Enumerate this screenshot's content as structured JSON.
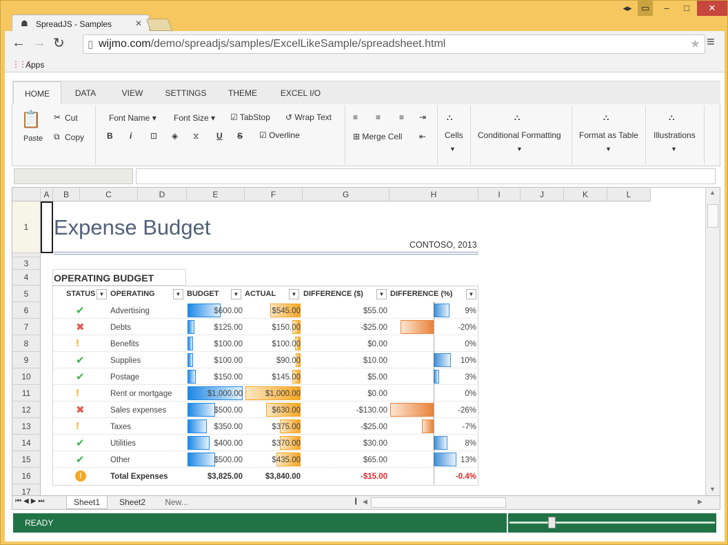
{
  "browser": {
    "tab_title": "SpreadJS - Samples",
    "url_host": "wijmo.com",
    "url_path": "/demo/spreadjs/samples/ExcelLikeSample/spreadsheet.html",
    "bookmarks_apps": "Apps"
  },
  "ribbon": {
    "tabs": [
      "HOME",
      "DATA",
      "VIEW",
      "SETTINGS",
      "THEME",
      "EXCEL I/O"
    ],
    "paste": "Paste",
    "cut": "Cut",
    "copy": "Copy",
    "font_name": "Font Name",
    "font_size": "Font Size",
    "bold": "B",
    "italic": "i",
    "underline": "U",
    "strike": "S",
    "tabstop": "TabStop",
    "wrap_text": "Wrap Text",
    "overline": "Overline",
    "merge_cell": "Merge Cell",
    "cells": "Cells",
    "conditional_formatting": "Conditional Formatting",
    "format_as_table": "Format as Table",
    "illustrations": "Illustrations"
  },
  "columns": [
    "A",
    "B",
    "C",
    "D",
    "E",
    "F",
    "G",
    "H",
    "I",
    "J",
    "K",
    "L"
  ],
  "rows": [
    "1",
    "3",
    "4",
    "5",
    "6",
    "7",
    "8",
    "9",
    "10",
    "11",
    "12",
    "13",
    "14",
    "15",
    "16",
    "17"
  ],
  "sheet": {
    "title": "Expense Budget",
    "company": "CONTOSO, 2013",
    "section": "OPERATING BUDGET",
    "headers": [
      "STATUS",
      "OPERATING",
      "BUDGET",
      "ACTUAL",
      "DIFFERENCE ($)",
      "DIFFERENCE (%)"
    ],
    "data_rows": [
      {
        "status": "ok",
        "name": "Advertising",
        "budget": "$600.00",
        "actual": "$545.00",
        "diff": "$55.00",
        "pct": "9%",
        "budget_v": 600,
        "actual_v": 545,
        "pct_v": 9
      },
      {
        "status": "bad",
        "name": "Debts",
        "budget": "$125.00",
        "actual": "$150.00",
        "diff": "-$25.00",
        "pct": "-20%",
        "budget_v": 125,
        "actual_v": 150,
        "pct_v": -20
      },
      {
        "status": "warn",
        "name": "Benefits",
        "budget": "$100.00",
        "actual": "$100.00",
        "diff": "$0.00",
        "pct": "0%",
        "budget_v": 100,
        "actual_v": 100,
        "pct_v": 0
      },
      {
        "status": "ok",
        "name": "Supplies",
        "budget": "$100.00",
        "actual": "$90.00",
        "diff": "$10.00",
        "pct": "10%",
        "budget_v": 100,
        "actual_v": 90,
        "pct_v": 10
      },
      {
        "status": "ok",
        "name": "Postage",
        "budget": "$150.00",
        "actual": "$145.00",
        "diff": "$5.00",
        "pct": "3%",
        "budget_v": 150,
        "actual_v": 145,
        "pct_v": 3
      },
      {
        "status": "warn",
        "name": "Rent or mortgage",
        "budget": "$1,000.00",
        "actual": "$1,000.00",
        "diff": "$0.00",
        "pct": "0%",
        "budget_v": 1000,
        "actual_v": 1000,
        "pct_v": 0
      },
      {
        "status": "bad",
        "name": "Sales expenses",
        "budget": "$500.00",
        "actual": "$630.00",
        "diff": "-$130.00",
        "pct": "-26%",
        "budget_v": 500,
        "actual_v": 630,
        "pct_v": -26
      },
      {
        "status": "warn",
        "name": "Taxes",
        "budget": "$350.00",
        "actual": "$375.00",
        "diff": "-$25.00",
        "pct": "-7%",
        "budget_v": 350,
        "actual_v": 375,
        "pct_v": -7
      },
      {
        "status": "ok",
        "name": "Utilities",
        "budget": "$400.00",
        "actual": "$370.00",
        "diff": "$30.00",
        "pct": "8%",
        "budget_v": 400,
        "actual_v": 370,
        "pct_v": 8
      },
      {
        "status": "ok",
        "name": "Other",
        "budget": "$500.00",
        "actual": "$435.00",
        "diff": "$65.00",
        "pct": "13%",
        "budget_v": 500,
        "actual_v": 435,
        "pct_v": 13
      }
    ],
    "total": {
      "name": "Total Expenses",
      "budget": "$3,825.00",
      "actual": "$3,840.00",
      "diff": "-$15.00",
      "pct": "-0.4%"
    }
  },
  "sheet_tabs": [
    "Sheet1",
    "Sheet2",
    "New..."
  ],
  "status": "READY",
  "colors": {
    "status_bar": "#217346",
    "budget_bar": "#1e88e5",
    "actual_bar": "#f5a623",
    "negative": "#e8833a",
    "ok": "#3cb54a",
    "bad": "#e05a4f",
    "warn": "#f5a623"
  }
}
